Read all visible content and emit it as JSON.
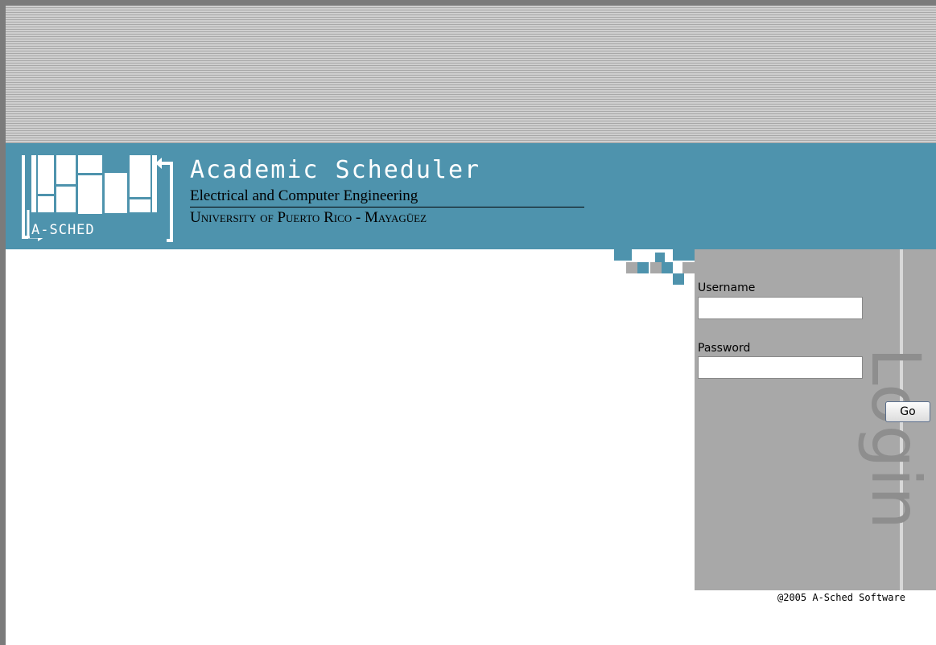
{
  "header": {
    "logo_text": "A-SCHED",
    "title": "Academic Scheduler",
    "department": "Electrical and Computer Engineering",
    "university": "University of Puerto Rico - Mayagüez"
  },
  "login": {
    "watermark": "Login",
    "username_label": "Username",
    "username_value": "",
    "password_label": "Password",
    "password_value": "",
    "go_label": "Go"
  },
  "footer": {
    "copyright": "@2005 A-Sched Software"
  },
  "colors": {
    "banner": "#4e93ad",
    "panel": "#a8a8a8",
    "frame": "#7b7b7b"
  }
}
